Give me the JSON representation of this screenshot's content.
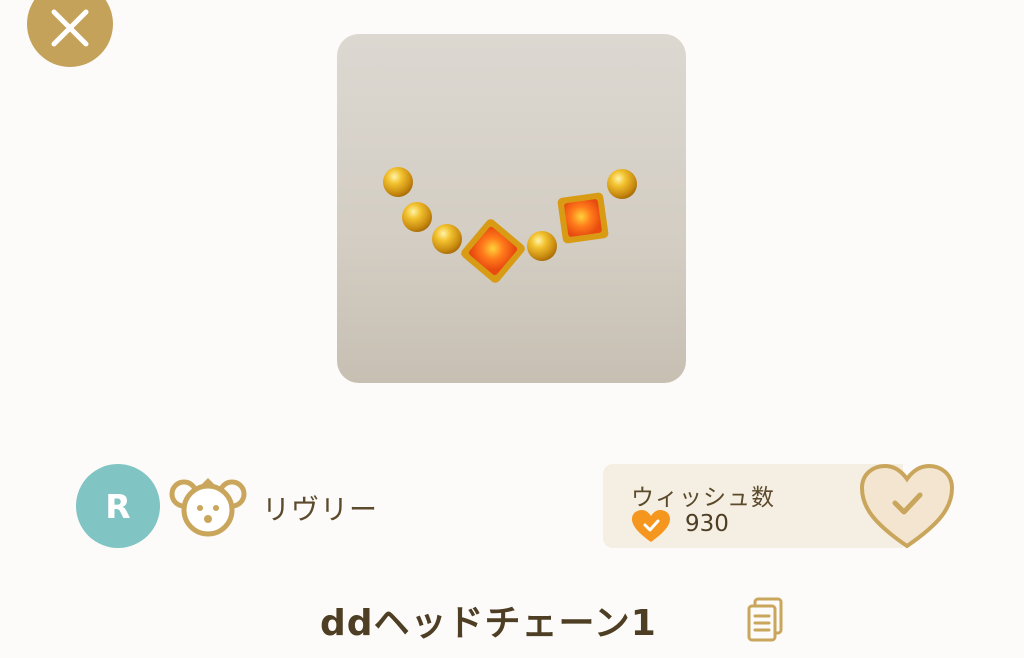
{
  "header": {
    "close_icon": "close-icon"
  },
  "item": {
    "title": "ddヘッドチェーン1",
    "copy_icon": "copy-document-icon"
  },
  "creator": {
    "avatar_letter": "R",
    "avatar_color": "#80c4c3",
    "badge_icon": "bear-icon",
    "name": "リヴリー"
  },
  "wish": {
    "label": "ウィッシュ数",
    "count": "930",
    "count_icon": "heart-check-icon",
    "button_icon": "heart-check-outline-icon"
  },
  "colors": {
    "accent": "#c4a25a",
    "heart": "#f5961e",
    "text": "#4d3e24",
    "panel": "#f5eee2"
  }
}
